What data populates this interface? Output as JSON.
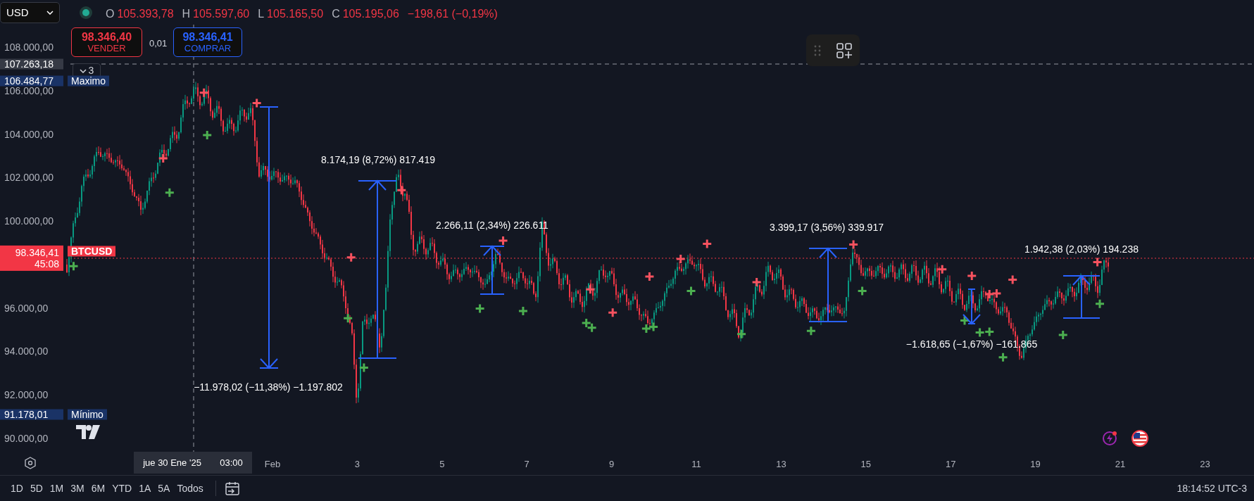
{
  "toolbar": {
    "currency_select": {
      "value": "USD"
    }
  },
  "legend": {
    "items": [
      {
        "key": "O",
        "value": "105.393,78"
      },
      {
        "key": "H",
        "value": "105.597,60"
      },
      {
        "key": "L",
        "value": "105.165,50"
      },
      {
        "key": "C",
        "value": "105.195,06"
      }
    ],
    "change": "−198,61 (−0,19%)"
  },
  "order_panel": {
    "sell": {
      "price": "98.346,40",
      "label": "VENDER"
    },
    "spread": "0,01",
    "buy": {
      "price": "98.346,41",
      "label": "COMPRAR"
    }
  },
  "indicator_toggle": {
    "count": "3"
  },
  "price_axis": {
    "ticks": [
      "108.000,00",
      "106.000,00",
      "104.000,00",
      "102.000,00",
      "100.000,00",
      "96.000,00",
      "94.000,00",
      "92.000,00",
      "90.000,00"
    ],
    "markers": [
      {
        "kind": "crosshair",
        "value": "107.263,18"
      },
      {
        "kind": "high",
        "value": "106.484,77",
        "tag": "Maximo"
      },
      {
        "kind": "last",
        "value": "98.346,41",
        "countdown": "45:08",
        "tag": "BTCUSD"
      },
      {
        "kind": "low",
        "value": "91.178,01",
        "tag": "Mínimo"
      }
    ]
  },
  "measurements": [
    {
      "kind": "down",
      "label": "−11.978,02 (−11,38%) −1.197.802"
    },
    {
      "kind": "up",
      "label": "8.174,19 (8,72%) 817.419"
    },
    {
      "kind": "up",
      "label": "2.266,11 (2,34%) 226.611"
    },
    {
      "kind": "up",
      "label": "3.399,17 (3,56%) 339.917"
    },
    {
      "kind": "down",
      "label": "−1.618,65 (−1,67%) −161.865"
    },
    {
      "kind": "up",
      "label": "1.942,38 (2,03%) 194.238"
    }
  ],
  "time_axis": {
    "crosshair_date": "jue 30 Ene '25",
    "crosshair_time": "03:00",
    "ticks": [
      "Feb",
      "3",
      "5",
      "7",
      "9",
      "11",
      "13",
      "15",
      "17",
      "19",
      "21",
      "23"
    ]
  },
  "range_buttons": [
    {
      "label": "1D"
    },
    {
      "label": "5D"
    },
    {
      "label": "1M"
    },
    {
      "label": "3M"
    },
    {
      "label": "6M"
    },
    {
      "label": "YTD"
    },
    {
      "label": "1A"
    },
    {
      "label": "5A"
    },
    {
      "label": "Todos"
    }
  ],
  "clock": "18:14:52 UTC-3"
}
